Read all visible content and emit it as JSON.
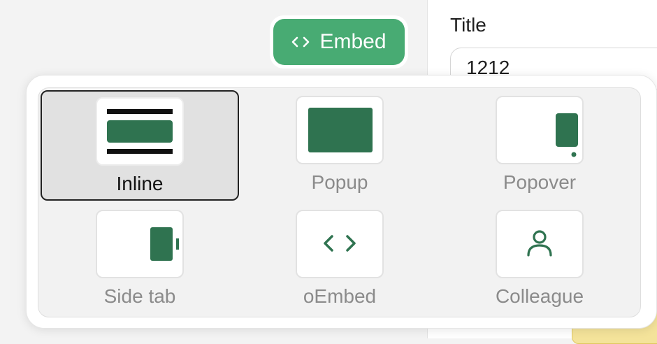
{
  "form": {
    "title_label": "Title",
    "title_value": "1212"
  },
  "toolbar": {
    "embed_label": "Embed",
    "embed_icon": "code-icon"
  },
  "embed_menu": {
    "options": [
      {
        "label": "Inline",
        "icon": "inline-embed-icon",
        "selected": true
      },
      {
        "label": "Popup",
        "icon": "popup-embed-icon",
        "selected": false
      },
      {
        "label": "Popover",
        "icon": "popover-embed-icon",
        "selected": false
      },
      {
        "label": "Side tab",
        "icon": "side-tab-embed-icon",
        "selected": false
      },
      {
        "label": "oEmbed",
        "icon": "code-icon",
        "selected": false
      },
      {
        "label": "Colleague",
        "icon": "user-icon",
        "selected": false
      }
    ]
  },
  "colors": {
    "accent_green": "#48ab73",
    "icon_green": "#2f7350",
    "selected_border": "#222222"
  }
}
